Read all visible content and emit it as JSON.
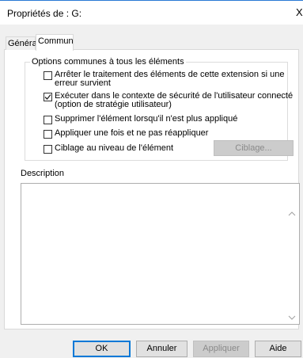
{
  "window": {
    "title": "Propriétés de : G:",
    "close_glyph": "X"
  },
  "tabs": [
    {
      "label": "Général",
      "active": false
    },
    {
      "label": "Commun",
      "active": true
    }
  ],
  "options": {
    "group_title": "Options communes à tous les éléments",
    "items": [
      {
        "label_line1": "Arrêter le traitement des éléments de cette extension si une",
        "label_line2": "erreur survient",
        "checked": false
      },
      {
        "label_line1": "Exécuter dans le contexte de sécurité de l'utilisateur connecté",
        "label_line2": "(option de stratégie utilisateur)",
        "checked": true
      },
      {
        "label_line1": "Supprimer l'élément lorsqu'il n'est plus appliqué",
        "checked": false
      },
      {
        "label_line1": "Appliquer une fois et ne pas réappliquer",
        "checked": false
      },
      {
        "label_line1": "Ciblage au niveau de l'élément",
        "checked": false
      }
    ],
    "targeting_button": "Ciblage..."
  },
  "description": {
    "label": "Description",
    "value": ""
  },
  "buttons": {
    "ok": "OK",
    "cancel": "Annuler",
    "apply": "Appliquer",
    "help": "Aide"
  }
}
